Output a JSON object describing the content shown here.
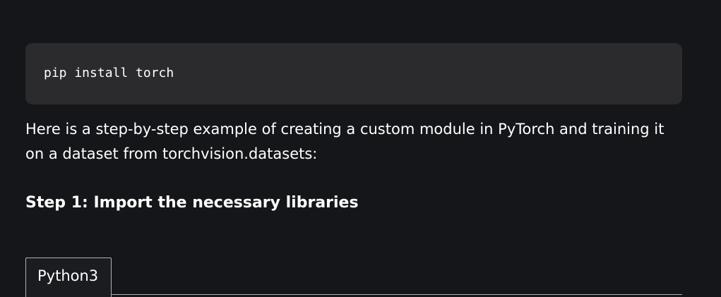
{
  "code_block": {
    "text": "pip install torch"
  },
  "intro_paragraph": {
    "text": "Here is a step-by-step example of creating a custom module in PyTorch and training it on a dataset from torchvision.datasets:"
  },
  "step_heading": {
    "text": "Step 1: Import the necessary libraries"
  },
  "tabs": [
    {
      "label": "Python3",
      "selected": true
    }
  ],
  "colors": {
    "page_background": "#151619",
    "code_background": "#2b2b2e",
    "text": "#ffffff",
    "tab_border": "#aeb0b4"
  }
}
